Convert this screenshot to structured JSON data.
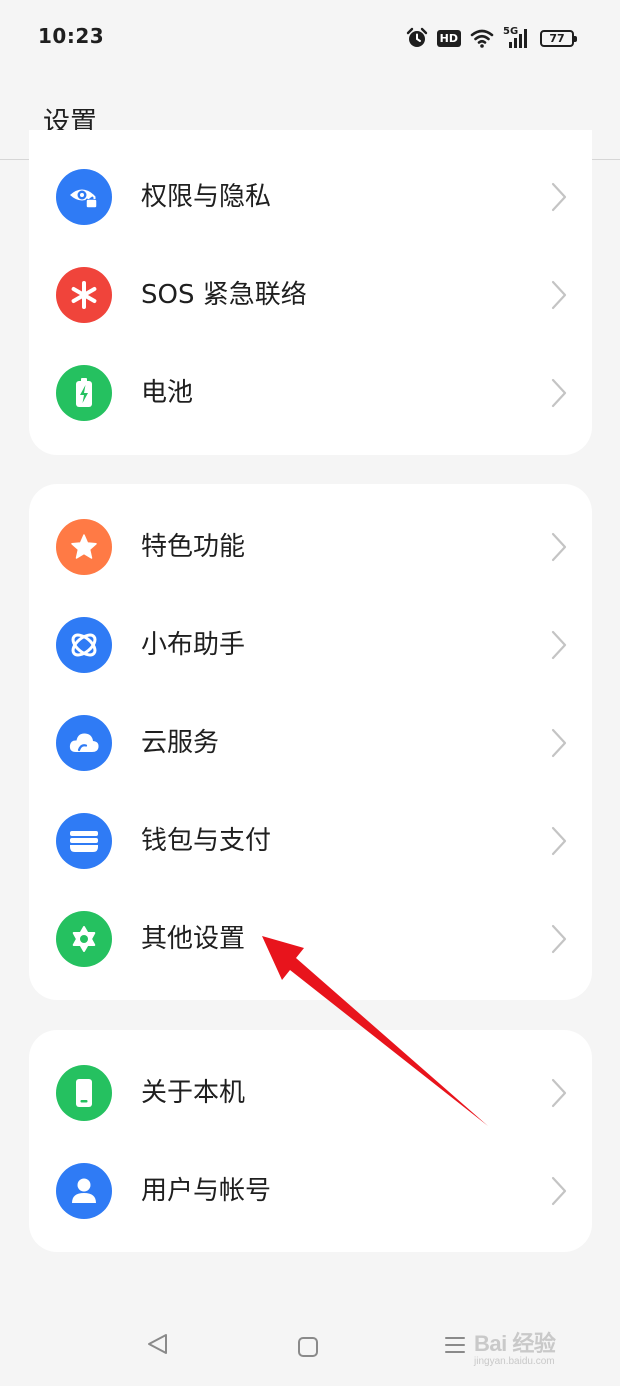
{
  "status_bar": {
    "time": "10:23",
    "hd": "HD",
    "network": "5G",
    "battery": "77",
    "icons": [
      "alarm-icon",
      "hd-icon",
      "wifi-icon",
      "signal-5g-icon",
      "battery-icon"
    ]
  },
  "header": {
    "title": "设置"
  },
  "groups": [
    {
      "items": [
        {
          "label": "权限与隐私",
          "icon": "privacy-eye-lock-icon",
          "color": "#2f7bf5"
        },
        {
          "label": "SOS 紧急联络",
          "icon": "sos-asterisk-icon",
          "color": "#f0443b"
        },
        {
          "label": "电池",
          "icon": "battery-charge-icon",
          "color": "#25c160"
        }
      ]
    },
    {
      "items": [
        {
          "label": "特色功能",
          "icon": "star-icon",
          "color": "#ff7a45"
        },
        {
          "label": "小布助手",
          "icon": "assistant-orbit-icon",
          "color": "#2f7bf5"
        },
        {
          "label": "云服务",
          "icon": "cloud-icon",
          "color": "#2f7bf5"
        },
        {
          "label": "钱包与支付",
          "icon": "wallet-icon",
          "color": "#2f7bf5"
        },
        {
          "label": "其他设置",
          "icon": "gear-icon",
          "color": "#25c160"
        }
      ]
    },
    {
      "items": [
        {
          "label": "关于本机",
          "icon": "phone-icon",
          "color": "#25c160"
        },
        {
          "label": "用户与帐号",
          "icon": "user-icon",
          "color": "#2f7bf5"
        }
      ]
    }
  ],
  "nav_bar": {
    "icons": [
      "back-icon",
      "home-icon",
      "menu-icon"
    ]
  },
  "watermark": {
    "text": "Bai 经验",
    "sub": "jingyan.baidu.com"
  },
  "annotation": {
    "icon": "red-arrow-icon",
    "color": "#e8141c",
    "points_to": "其他设置"
  }
}
